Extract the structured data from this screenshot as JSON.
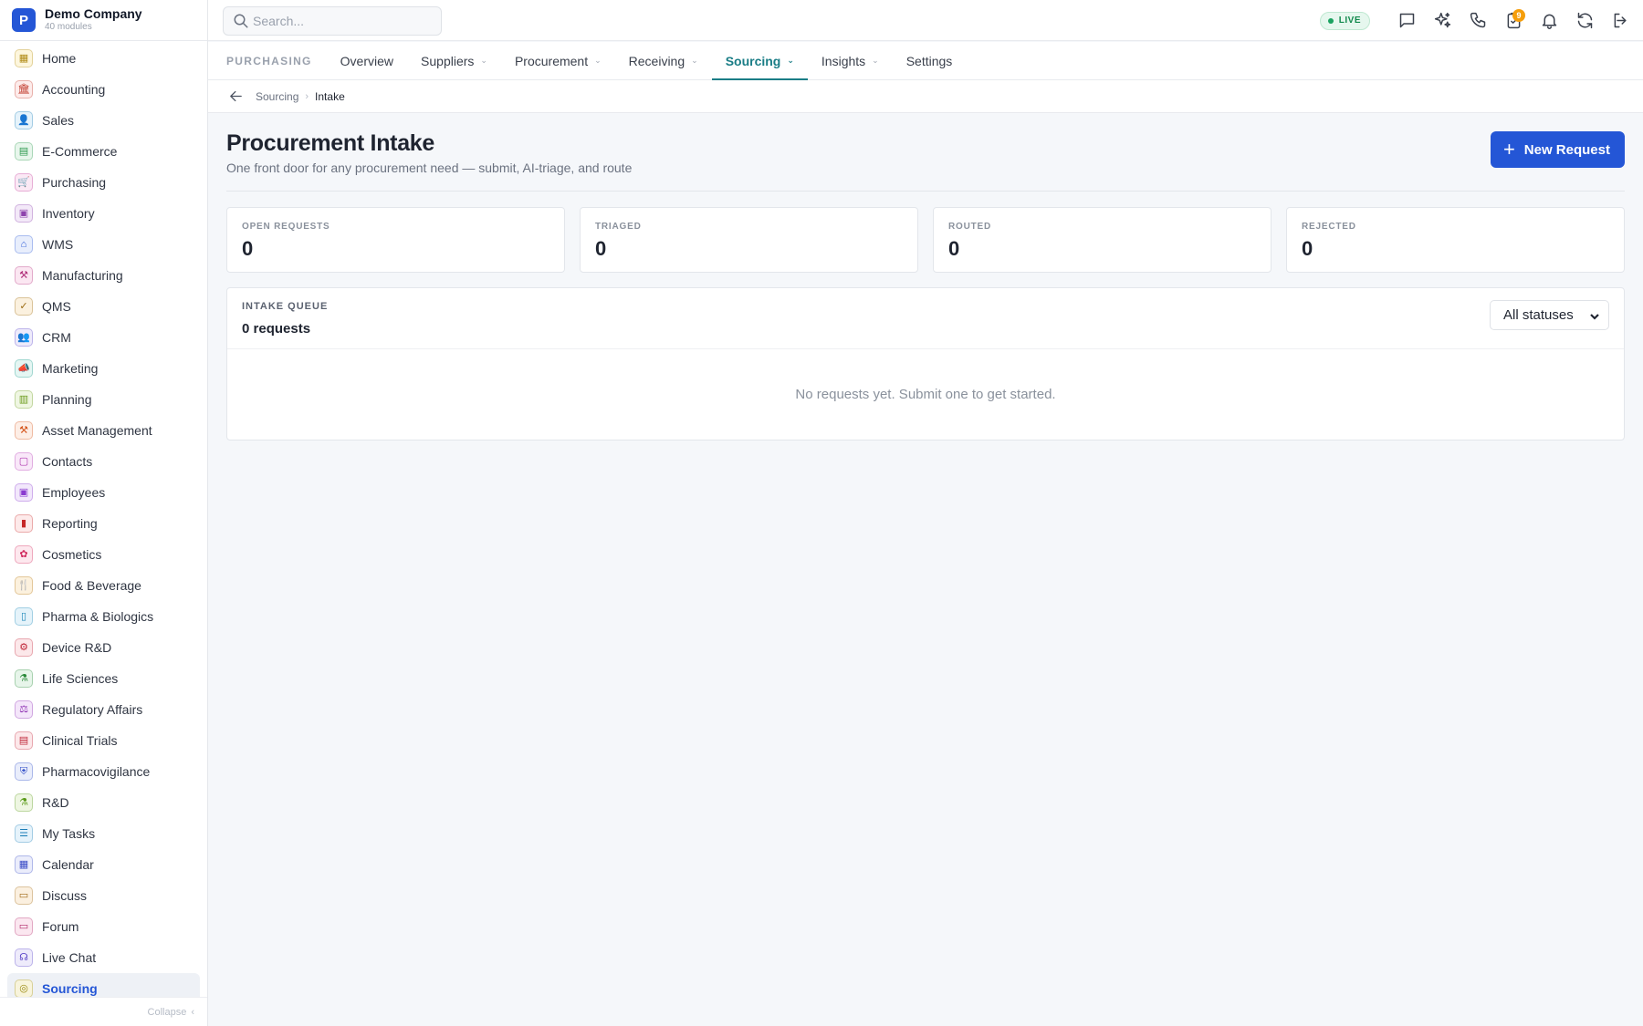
{
  "brand": {
    "logo_letter": "P",
    "name": "Demo Company",
    "sub": "40 modules"
  },
  "sidebar": {
    "items": [
      {
        "label": "Home",
        "icon": "▦",
        "icon_name": "grid-icon",
        "color": "#b08a14",
        "bg": "#fdf6dd"
      },
      {
        "label": "Accounting",
        "icon": "🏛",
        "icon_name": "bank-icon",
        "color": "#c0392b",
        "bg": "#fdeceb"
      },
      {
        "label": "Sales",
        "icon": "👤",
        "icon_name": "user-icon",
        "color": "#1d7fb8",
        "bg": "#e6f3fb"
      },
      {
        "label": "E-Commerce",
        "icon": "▤",
        "icon_name": "store-icon",
        "color": "#2e9a4f",
        "bg": "#e8f6ec"
      },
      {
        "label": "Purchasing",
        "icon": "🛒",
        "icon_name": "cart-icon",
        "color": "#c0399a",
        "bg": "#fbe9f5"
      },
      {
        "label": "Inventory",
        "icon": "▣",
        "icon_name": "box-icon",
        "color": "#8e44ad",
        "bg": "#f3e9f8"
      },
      {
        "label": "WMS",
        "icon": "⌂",
        "icon_name": "warehouse-icon",
        "color": "#2d5bd6",
        "bg": "#e8eefc"
      },
      {
        "label": "Manufacturing",
        "icon": "⚒",
        "icon_name": "factory-icon",
        "color": "#b0307a",
        "bg": "#fbe7f2"
      },
      {
        "label": "QMS",
        "icon": "✓",
        "icon_name": "check-badge-icon",
        "color": "#9a6a10",
        "bg": "#fbf1df"
      },
      {
        "label": "CRM",
        "icon": "👥",
        "icon_name": "users-icon",
        "color": "#5b46c8",
        "bg": "#eeebfb"
      },
      {
        "label": "Marketing",
        "icon": "📣",
        "icon_name": "megaphone-icon",
        "color": "#1a9a8a",
        "bg": "#e5f6f3"
      },
      {
        "label": "Planning",
        "icon": "▥",
        "icon_name": "calendar-grid-icon",
        "color": "#6a9a1a",
        "bg": "#eff6e2"
      },
      {
        "label": "Asset Management",
        "icon": "⚒",
        "icon_name": "tools-icon",
        "color": "#d4541a",
        "bg": "#fdeee6"
      },
      {
        "label": "Contacts",
        "icon": "▢",
        "icon_name": "contact-card-icon",
        "color": "#b03ab0",
        "bg": "#f9e8f9"
      },
      {
        "label": "Employees",
        "icon": "▣",
        "icon_name": "id-badge-icon",
        "color": "#8a3ad0",
        "bg": "#f2e8fb"
      },
      {
        "label": "Reporting",
        "icon": "▮",
        "icon_name": "bar-chart-icon",
        "color": "#c62828",
        "bg": "#fdeaea"
      },
      {
        "label": "Cosmetics",
        "icon": "✿",
        "icon_name": "flower-icon",
        "color": "#d12a5e",
        "bg": "#fde8ee"
      },
      {
        "label": "Food & Beverage",
        "icon": "🍴",
        "icon_name": "utensils-icon",
        "color": "#b07410",
        "bg": "#fcf1de"
      },
      {
        "label": "Pharma & Biologics",
        "icon": "▯",
        "icon_name": "vial-icon",
        "color": "#1a86b8",
        "bg": "#e5f3fa"
      },
      {
        "label": "Device R&D",
        "icon": "⚙",
        "icon_name": "cog-icon",
        "color": "#c0283a",
        "bg": "#fce8ea"
      },
      {
        "label": "Life Sciences",
        "icon": "⚗",
        "icon_name": "microscope-icon",
        "color": "#2a8a3a",
        "bg": "#e7f5ea"
      },
      {
        "label": "Regulatory Affairs",
        "icon": "⚖",
        "icon_name": "gavel-icon",
        "color": "#8a2ab0",
        "bg": "#f4e6fa"
      },
      {
        "label": "Clinical Trials",
        "icon": "▤",
        "icon_name": "clipboard-icon",
        "color": "#c0283a",
        "bg": "#fce8ea"
      },
      {
        "label": "Pharmacovigilance",
        "icon": "⛨",
        "icon_name": "shield-icon",
        "color": "#2d4bc6",
        "bg": "#e9edfb"
      },
      {
        "label": "R&D",
        "icon": "⚗",
        "icon_name": "flask-icon",
        "color": "#5a9a1a",
        "bg": "#eef6e2"
      },
      {
        "label": "My Tasks",
        "icon": "☰",
        "icon_name": "task-list-icon",
        "color": "#1d7fb8",
        "bg": "#e6f3fb"
      },
      {
        "label": "Calendar",
        "icon": "▦",
        "icon_name": "calendar-icon",
        "color": "#3a4bc6",
        "bg": "#ebedfb"
      },
      {
        "label": "Discuss",
        "icon": "▭",
        "icon_name": "chat-icon",
        "color": "#a06a18",
        "bg": "#fbf0e0"
      },
      {
        "label": "Forum",
        "icon": "▭",
        "icon_name": "forum-icon",
        "color": "#b02a6a",
        "bg": "#fbe7f0"
      },
      {
        "label": "Live Chat",
        "icon": "☊",
        "icon_name": "headset-icon",
        "color": "#5b46c8",
        "bg": "#eeebfb"
      },
      {
        "label": "Sourcing",
        "icon": "◎",
        "icon_name": "sourcing-icon",
        "color": "#9a8a10",
        "bg": "#f8f4dc",
        "active": true
      }
    ],
    "collapse_label": "Collapse"
  },
  "search": {
    "placeholder": "Search..."
  },
  "topbar": {
    "live_label": "LIVE",
    "notifications_count": "9"
  },
  "module": {
    "name": "PURCHASING",
    "tabs": [
      {
        "label": "Overview",
        "dropdown": false
      },
      {
        "label": "Suppliers",
        "dropdown": true
      },
      {
        "label": "Procurement",
        "dropdown": true
      },
      {
        "label": "Receiving",
        "dropdown": true
      },
      {
        "label": "Sourcing",
        "dropdown": true,
        "active": true
      },
      {
        "label": "Insights",
        "dropdown": true
      },
      {
        "label": "Settings",
        "dropdown": false
      }
    ]
  },
  "breadcrumb": {
    "parent": "Sourcing",
    "current": "Intake"
  },
  "page": {
    "title": "Procurement Intake",
    "subtitle": "One front door for any procurement need — submit, AI-triage, and route",
    "new_button": "New Request"
  },
  "stats": [
    {
      "label": "OPEN REQUESTS",
      "value": "0"
    },
    {
      "label": "TRIAGED",
      "value": "0"
    },
    {
      "label": "ROUTED",
      "value": "0"
    },
    {
      "label": "REJECTED",
      "value": "0"
    }
  ],
  "queue": {
    "label": "INTAKE QUEUE",
    "count": "0 requests",
    "filter_selected": "All statuses",
    "empty_text": "No requests yet. Submit one to get started."
  },
  "colors": {
    "accent": "#2456d6",
    "tab_active": "#1a7d86",
    "live": "#1aa260",
    "badge": "#f59e0b"
  }
}
